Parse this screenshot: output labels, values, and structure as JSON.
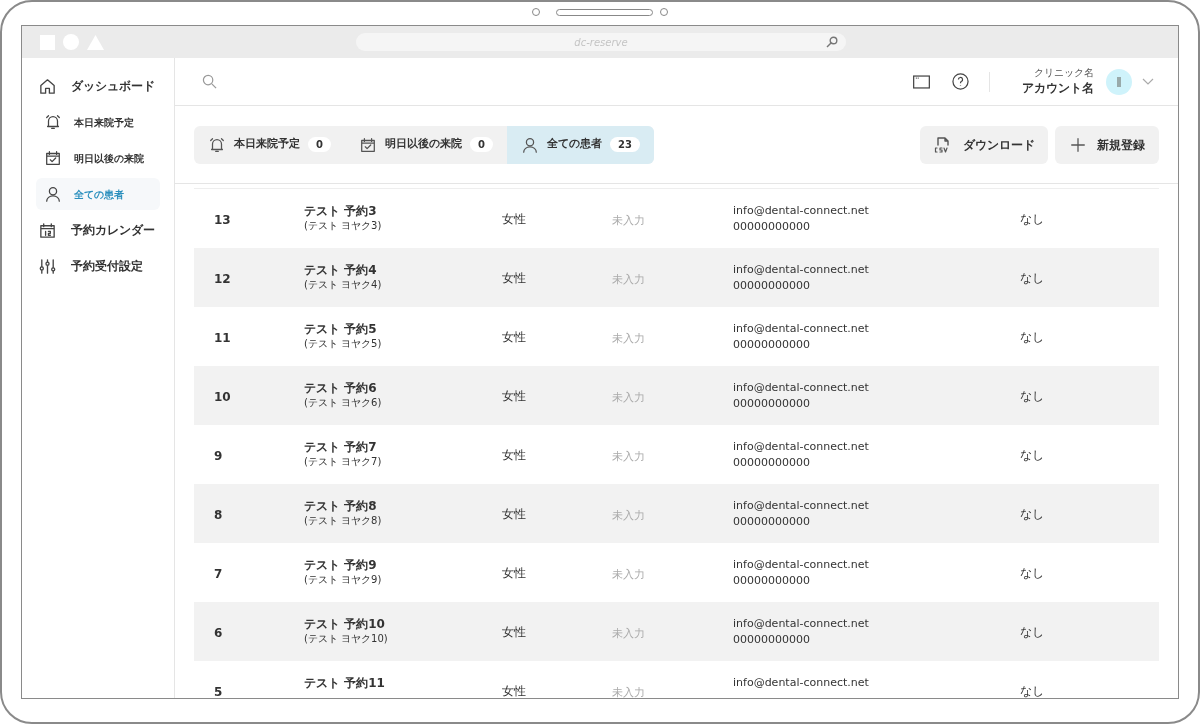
{
  "browser": {
    "address": "dc-reserve"
  },
  "sidebar": {
    "items": [
      {
        "kind": "home",
        "label": "ダッシュボード",
        "selected": false,
        "sub": false
      },
      {
        "kind": "bell",
        "label": "本日来院予定",
        "selected": false,
        "sub": true
      },
      {
        "kind": "calendar-check",
        "label": "明日以後の来院",
        "selected": false,
        "sub": true
      },
      {
        "kind": "user",
        "label": "全ての患者",
        "selected": true,
        "sub": true
      },
      {
        "kind": "calendar",
        "label": "予約カレンダー",
        "selected": false,
        "sub": false
      },
      {
        "kind": "sliders",
        "label": "予約受付設定",
        "selected": false,
        "sub": false
      }
    ]
  },
  "header": {
    "clinic": "クリニック名",
    "account": "アカウント名"
  },
  "tabs": [
    {
      "kind": "bell",
      "label": "本日来院予定",
      "count": "0",
      "selected": false
    },
    {
      "kind": "calendar-check",
      "label": "明日以後の来院",
      "count": "0",
      "selected": false
    },
    {
      "kind": "user",
      "label": "全ての患者",
      "count": "23",
      "selected": true
    }
  ],
  "actions": [
    {
      "kind": "csv",
      "label": "ダウンロード"
    },
    {
      "kind": "plus",
      "label": "新規登録"
    }
  ],
  "table": {
    "rows": [
      {
        "no": "13",
        "name": "テスト 予約3",
        "kana": "(テスト ヨヤク3)",
        "gender": "女性",
        "birth": "未入力",
        "email": "info@dental-connect.net",
        "phone": "00000000000",
        "note": "なし"
      },
      {
        "no": "12",
        "name": "テスト 予約4",
        "kana": "(テスト ヨヤク4)",
        "gender": "女性",
        "birth": "未入力",
        "email": "info@dental-connect.net",
        "phone": "00000000000",
        "note": "なし"
      },
      {
        "no": "11",
        "name": "テスト 予約5",
        "kana": "(テスト ヨヤク5)",
        "gender": "女性",
        "birth": "未入力",
        "email": "info@dental-connect.net",
        "phone": "00000000000",
        "note": "なし"
      },
      {
        "no": "10",
        "name": "テスト 予約6",
        "kana": "(テスト ヨヤク6)",
        "gender": "女性",
        "birth": "未入力",
        "email": "info@dental-connect.net",
        "phone": "00000000000",
        "note": "なし"
      },
      {
        "no": "9",
        "name": "テスト 予約7",
        "kana": "(テスト ヨヤク7)",
        "gender": "女性",
        "birth": "未入力",
        "email": "info@dental-connect.net",
        "phone": "00000000000",
        "note": "なし"
      },
      {
        "no": "8",
        "name": "テスト 予約8",
        "kana": "(テスト ヨヤク8)",
        "gender": "女性",
        "birth": "未入力",
        "email": "info@dental-connect.net",
        "phone": "00000000000",
        "note": "なし"
      },
      {
        "no": "7",
        "name": "テスト 予約9",
        "kana": "(テスト ヨヤク9)",
        "gender": "女性",
        "birth": "未入力",
        "email": "info@dental-connect.net",
        "phone": "00000000000",
        "note": "なし"
      },
      {
        "no": "6",
        "name": "テスト 予約10",
        "kana": "(テスト ヨヤク10)",
        "gender": "女性",
        "birth": "未入力",
        "email": "info@dental-connect.net",
        "phone": "00000000000",
        "note": "なし"
      },
      {
        "no": "5",
        "name": "テスト 予約11",
        "gender": "女性",
        "birth": "未入力",
        "email": "info@dental-connect.net",
        "note": "なし"
      }
    ]
  }
}
